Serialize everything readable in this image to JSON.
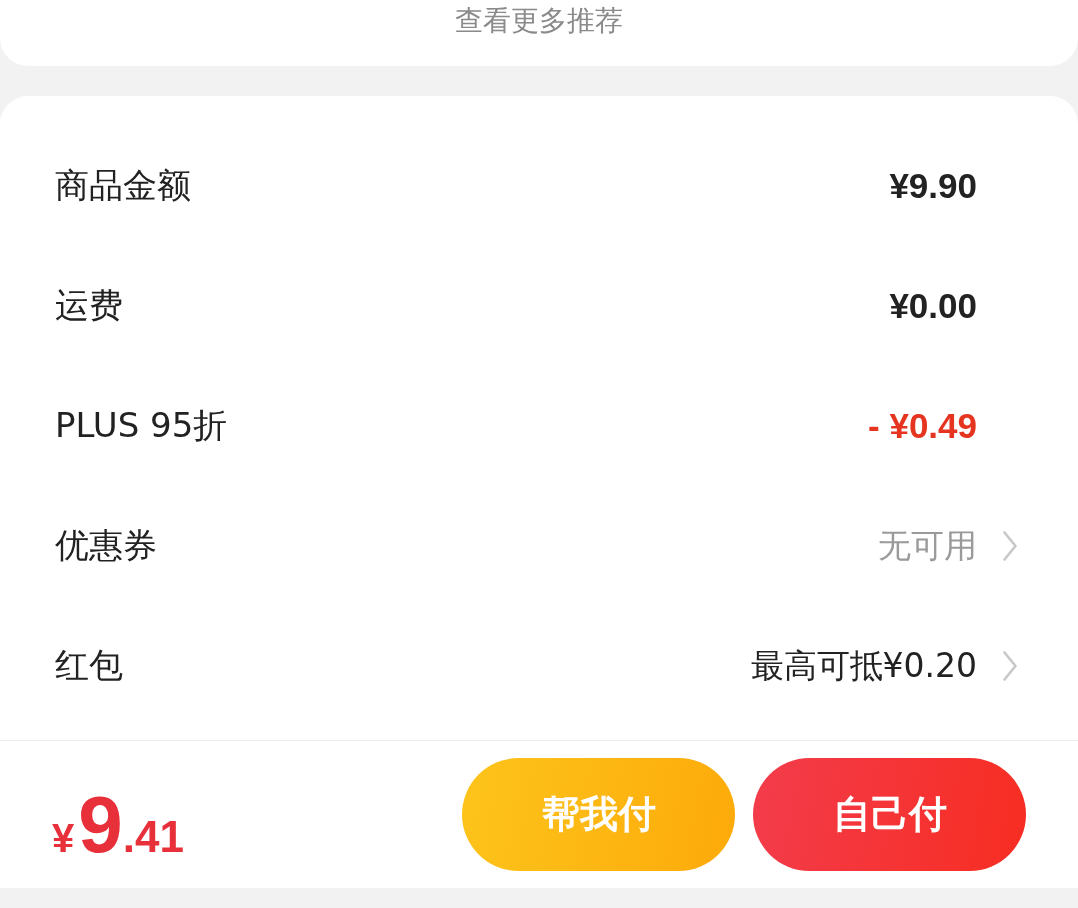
{
  "more_link": {
    "label": "查看更多推荐"
  },
  "summary": {
    "rows": [
      {
        "kind": "amount",
        "label": "商品金额",
        "value": "¥9.90",
        "disabled": false
      },
      {
        "kind": "amount",
        "label": "运费",
        "value": "¥0.00",
        "disabled": false
      },
      {
        "kind": "discount",
        "label": "PLUS 95折",
        "value": "- ¥0.49",
        "disabled": false
      },
      {
        "kind": "option",
        "label": "优惠券",
        "value": "无可用",
        "disabled": true
      },
      {
        "kind": "option",
        "label": "红包",
        "value": "最高可抵¥0.20",
        "disabled": false
      }
    ]
  },
  "checkout_bar": {
    "total": {
      "currency": "¥",
      "integer": "9",
      "fraction": ".41"
    },
    "buttons": [
      {
        "kind": "secondary",
        "label": "帮我付"
      },
      {
        "kind": "primary",
        "label": "自己付"
      }
    ]
  }
}
